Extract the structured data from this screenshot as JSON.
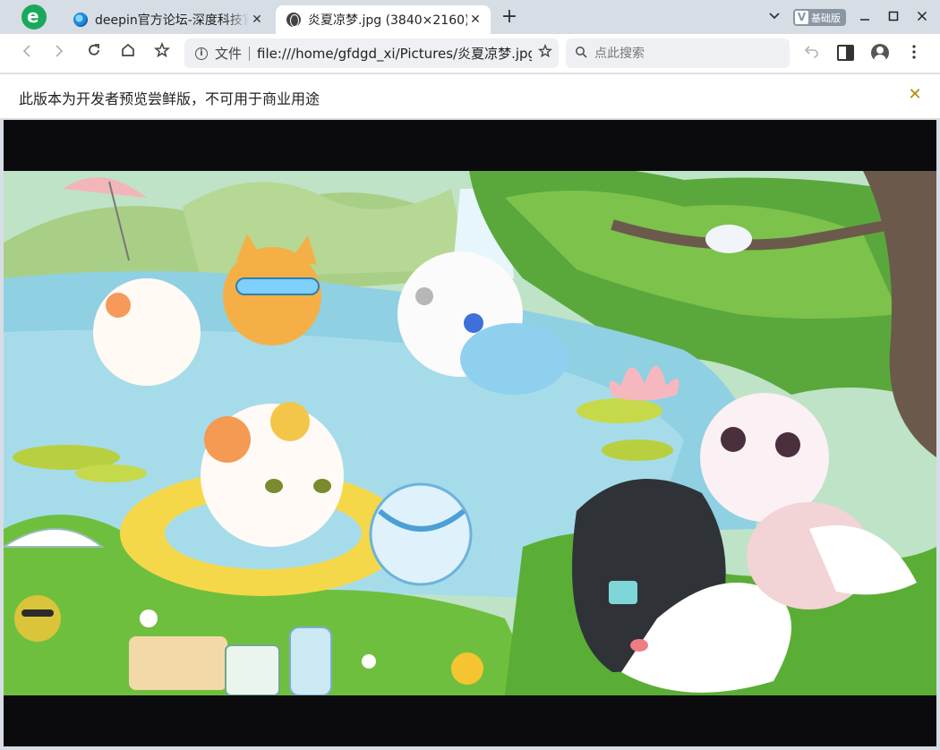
{
  "browser": {
    "logo_icon": "browser-e-logo-icon",
    "tabs": [
      {
        "title": "deepin官方论坛-深度科技官方",
        "favicon": "deepin-icon",
        "active": false
      },
      {
        "title": "炎夏凉梦.jpg (3840×2160)",
        "favicon": "globe-icon",
        "active": true
      }
    ],
    "new_tab_label": "+",
    "tab_search_icon": "chevron-down-icon",
    "version_badge": {
      "mark": "V",
      "label": "基础版"
    },
    "window_controls": {
      "minimize": "—",
      "maximize": "☐",
      "close": "✕"
    }
  },
  "toolbar": {
    "back_icon": "‹",
    "forward_icon": "›",
    "reload_icon": "↻",
    "home_icon": "⌂",
    "bookmark_icon": "☆",
    "omnibox": {
      "scheme_label": "文件",
      "url": "file:///home/gfdgd_xi/Pictures/炎夏凉梦.jpg",
      "star_icon": "☆"
    },
    "search": {
      "placeholder": "点此搜索"
    },
    "undo_icon": "↶",
    "menu_icon": "⋮"
  },
  "infobar": {
    "message": "此版本为开发者预览尝鲜版，不可用于商业用途",
    "close_icon": "✕"
  },
  "image": {
    "name": "炎夏凉梦.jpg",
    "resolution": "3840×2160"
  },
  "colors": {
    "accent_green": "#1aa95b",
    "tabstrip_bg": "#d7dde5",
    "viewport_bg": "#0b0b0d",
    "infobar_close": "#b8860b"
  }
}
